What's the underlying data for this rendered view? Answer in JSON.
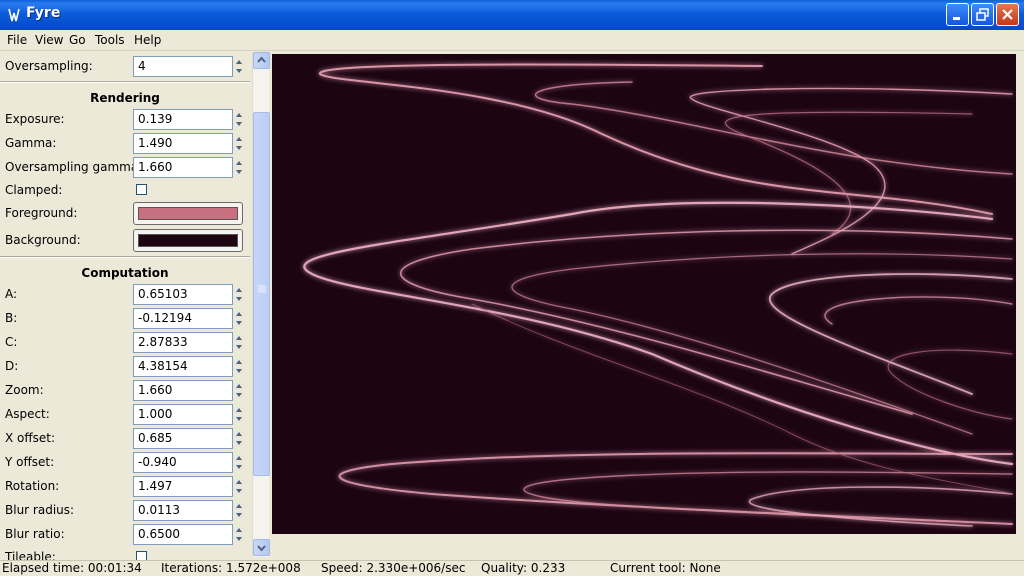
{
  "window": {
    "title": "Fyre",
    "minimize_icon": "minimize-icon",
    "maximize_icon": "restore-icon",
    "close_icon": "close-icon"
  },
  "menu": [
    {
      "label": "File"
    },
    {
      "label": "View"
    },
    {
      "label": "Go"
    },
    {
      "label": "Tools"
    },
    {
      "label": "Help"
    }
  ],
  "params": {
    "oversampling": {
      "label": "Oversampling:",
      "value": "4"
    },
    "rendering_title": "Rendering",
    "exposure": {
      "label": "Exposure:",
      "value": "0.139"
    },
    "gamma": {
      "label": "Gamma:",
      "value": "1.490"
    },
    "oversampling_gamma": {
      "label": "Oversampling gamma:",
      "value": "1.660"
    },
    "clamped": {
      "label": "Clamped:",
      "checked": false
    },
    "foreground": {
      "label": "Foreground:",
      "color": "#c87080"
    },
    "background": {
      "label": "Background:",
      "color": "#1c0411"
    },
    "computation_title": "Computation",
    "a": {
      "label": "A:",
      "value": "0.65103"
    },
    "b": {
      "label": "B:",
      "value": "-0.12194"
    },
    "c": {
      "label": "C:",
      "value": "2.87833"
    },
    "d": {
      "label": "D:",
      "value": "4.38154"
    },
    "zoom": {
      "label": "Zoom:",
      "value": "1.660"
    },
    "aspect": {
      "label": "Aspect:",
      "value": "1.000"
    },
    "x_offset": {
      "label": "X offset:",
      "value": "0.685"
    },
    "y_offset": {
      "label": "Y offset:",
      "value": "-0.940"
    },
    "rotation": {
      "label": "Rotation:",
      "value": "1.497"
    },
    "blur_radius": {
      "label": "Blur radius:",
      "value": "0.0113"
    },
    "blur_ratio": {
      "label": "Blur ratio:",
      "value": "0.6500"
    },
    "tileable": {
      "label": "Tileable:"
    }
  },
  "status": {
    "elapsed": "Elapsed time: 00:01:34",
    "iterations": "Iterations: 1.572e+008",
    "speed": "Speed: 2.330e+006/sec",
    "quality": "Quality: 0.233",
    "tool": "Current tool: None"
  },
  "colors": {
    "titlebar": "#0a5fd8",
    "render_bg": "#1c0411",
    "render_fg": "#e8a0b4"
  }
}
